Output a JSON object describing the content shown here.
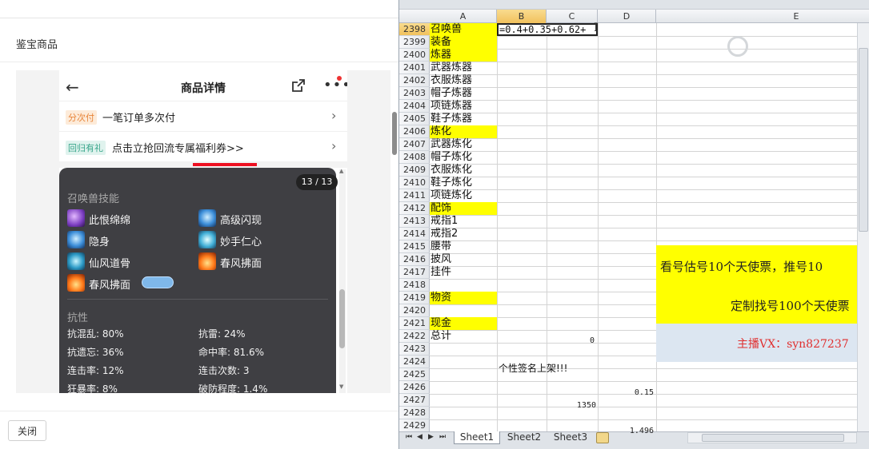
{
  "left": {
    "title": "鉴宝商品",
    "close_label": "关闭"
  },
  "phone": {
    "header_title": "商品详情",
    "promos": [
      {
        "tag": "分次付",
        "text": "一笔订单多次付"
      },
      {
        "tag": "回归有礼",
        "text": "点击立抢回流专属福利券>>"
      }
    ],
    "page_indicator": "13 / 13",
    "skills_title": "召唤兽技能",
    "skills": [
      {
        "name": "此恨绵绵",
        "icon": "purple-vortex-icon"
      },
      {
        "name": "高级闪现",
        "icon": "blue-flash-icon"
      },
      {
        "name": "隐身",
        "icon": "blue-stealth-icon"
      },
      {
        "name": "妙手仁心",
        "icon": "cyan-heal-icon"
      },
      {
        "name": "仙风道骨",
        "icon": "teal-spirit-icon"
      },
      {
        "name": "春风拂面",
        "icon": "fire-wind-icon"
      },
      {
        "name": "春风拂面",
        "icon": "fire-wind-icon"
      }
    ],
    "resist_title": "抗性",
    "stats": [
      {
        "label": "抗混乱: 80%"
      },
      {
        "label": "抗雷: 24%"
      },
      {
        "label": "抗遗忘: 36%"
      },
      {
        "label": "命中率: 81.6%"
      },
      {
        "label": "连击率: 12%"
      },
      {
        "label": "连击次数: 3"
      },
      {
        "label": "狂暴率: 8%"
      },
      {
        "label": "破防程度: 1.4%"
      }
    ]
  },
  "sheet": {
    "columns": [
      "A",
      "B",
      "C",
      "D",
      "E"
    ],
    "rows": [
      {
        "num": "2398",
        "a": "召唤兽",
        "yellow": true
      },
      {
        "num": "2399",
        "a": "装备",
        "yellow": true
      },
      {
        "num": "2400",
        "a": "炼器",
        "yellow": true
      },
      {
        "num": "2401",
        "a": "武器炼器",
        "yellow": false
      },
      {
        "num": "2402",
        "a": "衣服炼器",
        "yellow": false
      },
      {
        "num": "2403",
        "a": "帽子炼器",
        "yellow": false
      },
      {
        "num": "2404",
        "a": "项链炼器",
        "yellow": false
      },
      {
        "num": "2405",
        "a": "鞋子炼器",
        "yellow": false
      },
      {
        "num": "2406",
        "a": "炼化",
        "yellow": true
      },
      {
        "num": "2407",
        "a": "武器炼化",
        "yellow": false
      },
      {
        "num": "2408",
        "a": "帽子炼化",
        "yellow": false
      },
      {
        "num": "2409",
        "a": "衣服炼化",
        "yellow": false
      },
      {
        "num": "2410",
        "a": "鞋子炼化",
        "yellow": false
      },
      {
        "num": "2411",
        "a": "项链炼化",
        "yellow": false
      },
      {
        "num": "2412",
        "a": "配饰",
        "yellow": true
      },
      {
        "num": "2413",
        "a": "戒指1",
        "yellow": false
      },
      {
        "num": "2414",
        "a": "戒指2",
        "yellow": false
      },
      {
        "num": "2415",
        "a": "腰带",
        "yellow": false
      },
      {
        "num": "2416",
        "a": "披风",
        "yellow": false
      },
      {
        "num": "2417",
        "a": "挂件",
        "yellow": false
      },
      {
        "num": "2418",
        "a": "",
        "yellow": false
      },
      {
        "num": "2419",
        "a": "物资",
        "yellow": true
      },
      {
        "num": "2420",
        "a": "",
        "yellow": false
      },
      {
        "num": "2421",
        "a": "现金",
        "yellow": true
      },
      {
        "num": "2422",
        "a": "总计",
        "yellow": false
      },
      {
        "num": "2423",
        "a": "",
        "yellow": false
      },
      {
        "num": "2424",
        "a": "",
        "yellow": false
      },
      {
        "num": "2425",
        "a": "",
        "yellow": false
      },
      {
        "num": "2426",
        "a": "",
        "yellow": false
      },
      {
        "num": "2427",
        "a": "",
        "yellow": false
      },
      {
        "num": "2428",
        "a": "",
        "yellow": false
      },
      {
        "num": "2429",
        "a": "",
        "yellow": false
      }
    ],
    "formula_in_b2398": "=0.4+0.35+0.62+",
    "b2422": "0",
    "row2424_text": "个性签名上架!!!",
    "d2426": "0.15",
    "c2427": "1350",
    "d2429": "1.496",
    "merged_e_text1": "看号估号10个天使票，推号10",
    "merged_e_text2": "定制找号100个天使票",
    "merged_e_text3": "主播VX：syn827237",
    "tabs": [
      "Sheet1",
      "Sheet2",
      "Sheet3"
    ],
    "nav": [
      "⏮",
      "◀",
      "▶",
      "⏭"
    ]
  }
}
